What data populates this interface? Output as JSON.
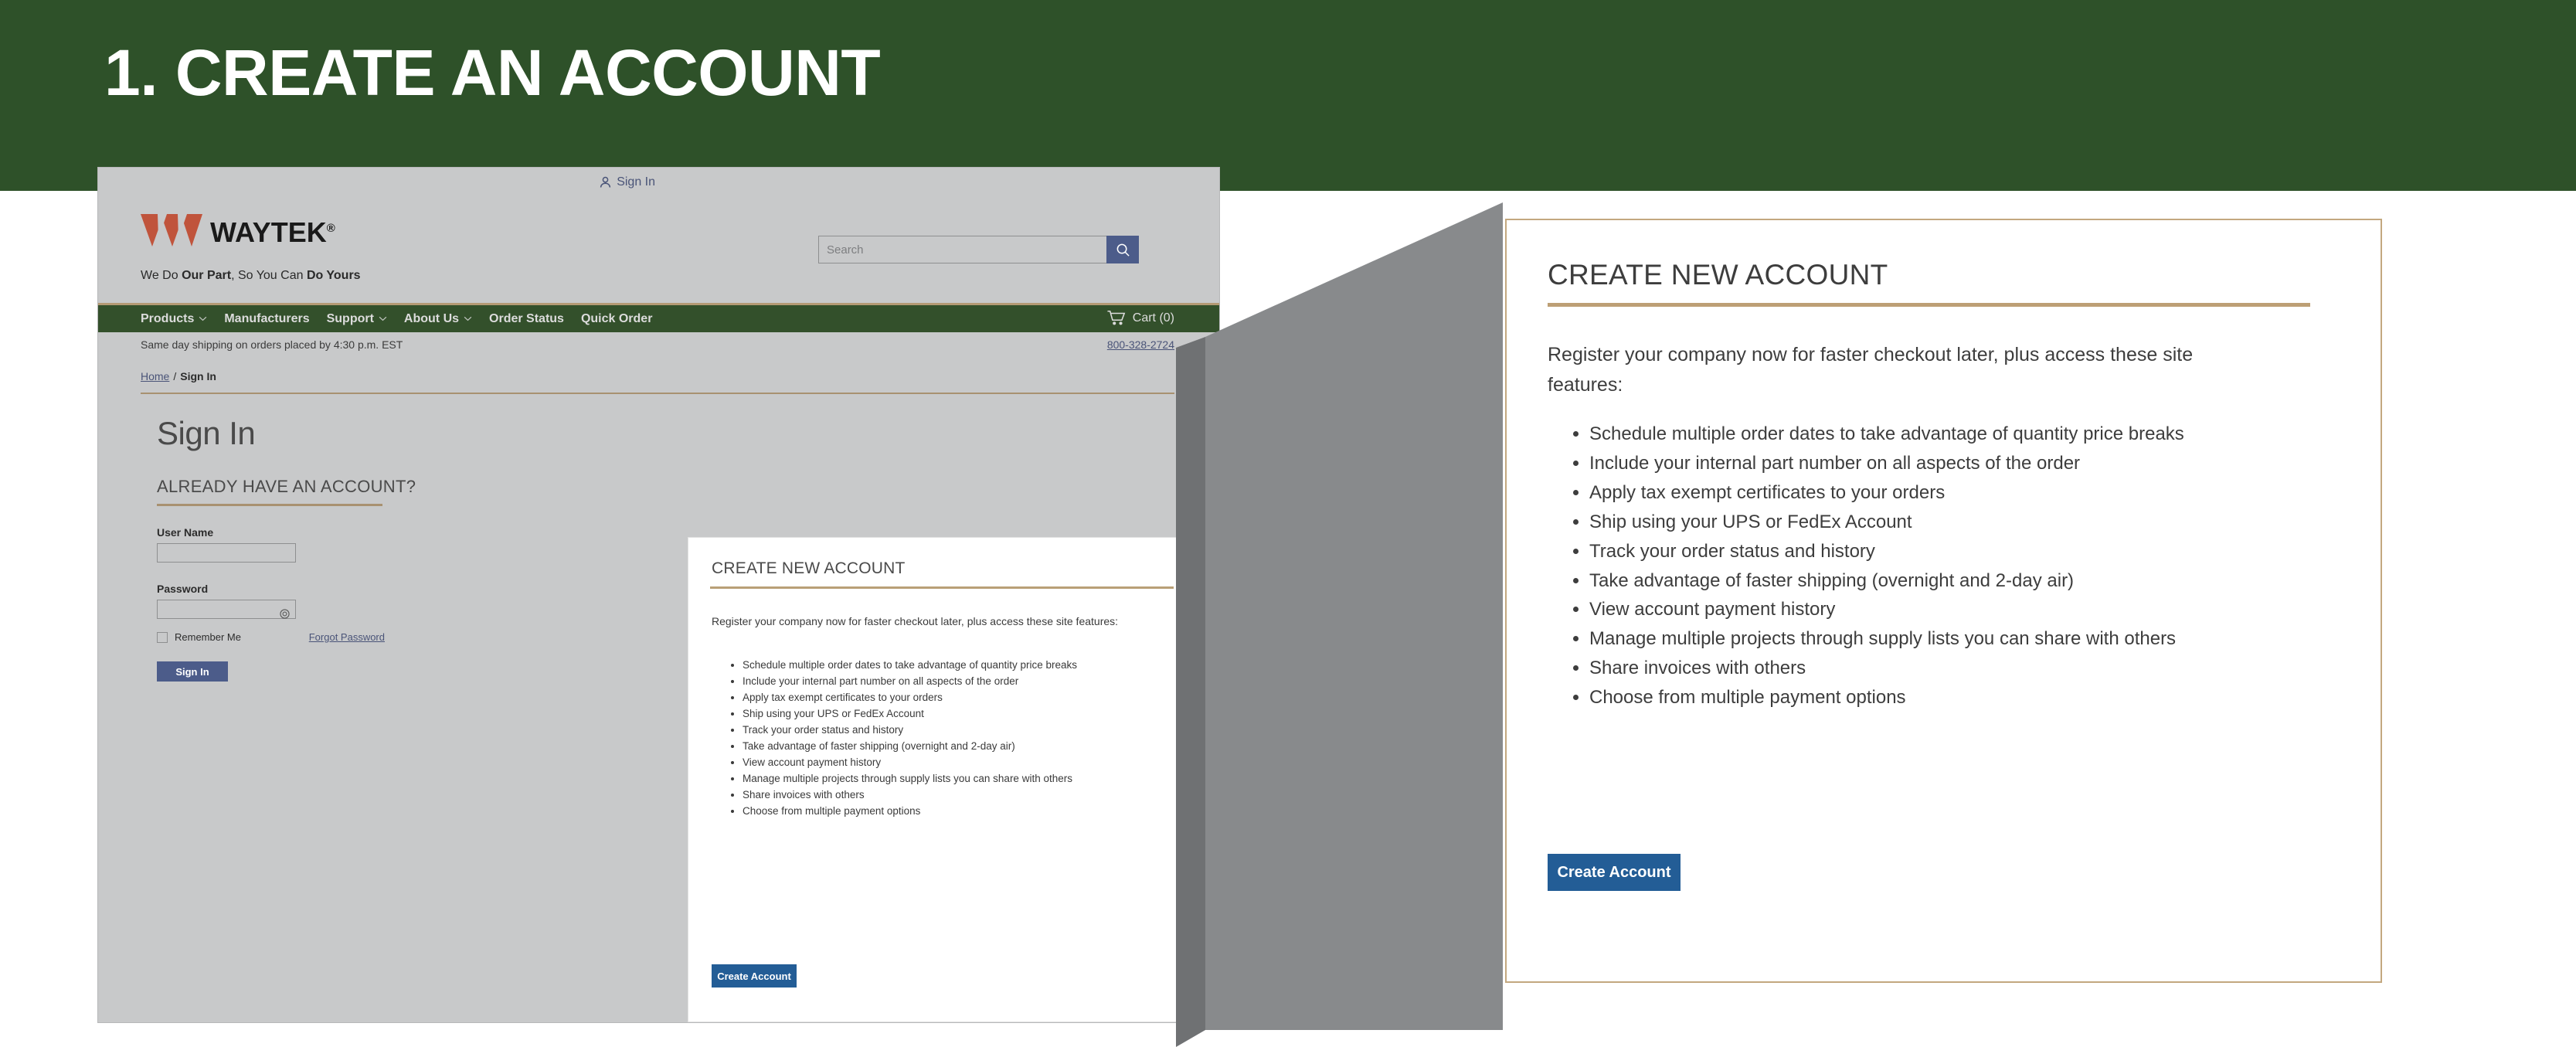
{
  "slide": {
    "title": "1. CREATE AN ACCOUNT",
    "banner_color": "#2e5129"
  },
  "screenshot": {
    "topbar": {
      "sign_in_label": "Sign In",
      "sign_in_icon": "user-icon"
    },
    "brand": {
      "logo_icon": "waytek-triangles-logo",
      "logo_text": "WAYTEK",
      "registered_mark": "®",
      "tagline_part1": "We Do ",
      "tagline_bold1": "Our Part",
      "tagline_part2": ", So You Can ",
      "tagline_bold2": "Do Yours"
    },
    "search": {
      "placeholder": "Search",
      "value": "",
      "button_icon": "search-icon"
    },
    "nav": {
      "items": [
        {
          "label": "Products",
          "has_chevron": true
        },
        {
          "label": "Manufacturers",
          "has_chevron": false
        },
        {
          "label": "Support",
          "has_chevron": true
        },
        {
          "label": "About Us",
          "has_chevron": true
        },
        {
          "label": "Order Status",
          "has_chevron": false
        },
        {
          "label": "Quick Order",
          "has_chevron": false
        }
      ],
      "cart_label": "Cart (0)",
      "cart_icon": "shopping-cart-icon",
      "bar_color": "#33502b"
    },
    "ship_bar": {
      "message": "Same day shipping on orders placed by 4:30 p.m. EST",
      "phone": "800-328-2724"
    },
    "breadcrumb": {
      "home": "Home",
      "separator": "/",
      "current": "Sign In"
    },
    "page_title": "Sign In",
    "sign_in_form": {
      "section_heading": "ALREADY HAVE AN ACCOUNT?",
      "username_label": "User Name",
      "username_value": "",
      "password_label": "Password",
      "password_value": "",
      "show_password_icon": "eye-icon",
      "remember_label": "Remember Me",
      "forgot_label": "Forgot Password",
      "submit_label": "Sign In",
      "submit_color": "#4c5c8a"
    },
    "create_card": {
      "heading": "CREATE NEW ACCOUNT",
      "intro": "Register your company now for faster checkout later, plus access these site features:",
      "features": [
        "Schedule multiple order dates to take advantage of quantity price breaks",
        "Include your internal part number on all aspects of the order",
        "Apply tax exempt certificates to your orders",
        "Ship using your UPS or FedEx Account",
        "Track your order status and history",
        "Take advantage of faster shipping (overnight and 2-day air)",
        "View account payment history",
        "Manage multiple projects through supply lists you can share with others",
        "Share invoices with others",
        "Choose from multiple payment options"
      ],
      "button_label": "Create Account",
      "button_color": "#235d96",
      "accent_color": "#b9a077"
    }
  },
  "zoom_panel": {
    "heading": "CREATE NEW ACCOUNT",
    "intro": "Register your company now for faster checkout later, plus access these site features:",
    "features": [
      "Schedule multiple order dates to take advantage of quantity price breaks",
      "Include your internal part number on all aspects of the order",
      "Apply tax exempt certificates to your orders",
      "Ship using your UPS or FedEx Account",
      "Track your order status and history",
      "Take advantage of faster shipping (overnight and 2-day air)",
      "View account payment history",
      "Manage multiple projects through supply lists you can share with others",
      "Share invoices with others",
      "Choose from multiple payment options"
    ],
    "button_label": "Create Account",
    "button_color": "#235d96",
    "border_color": "#c3a87f",
    "accent_color": "#bd9f75"
  }
}
